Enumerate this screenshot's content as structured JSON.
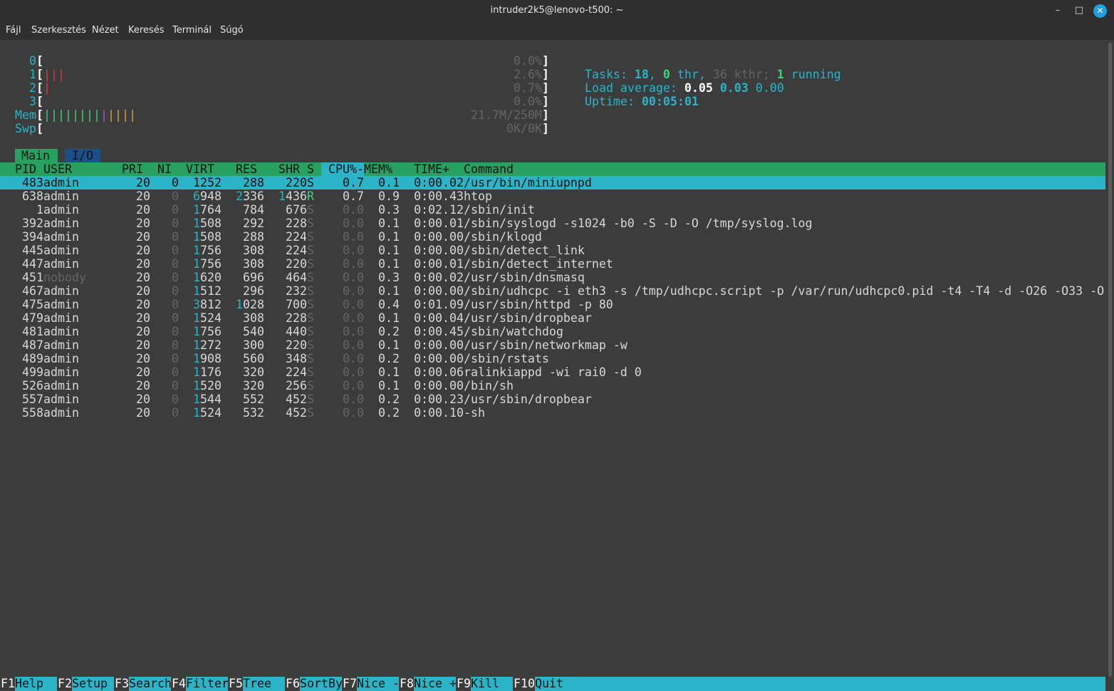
{
  "window": {
    "title": "intruder2k5@lenovo-t500: ~",
    "minimize_glyph": "–",
    "maximize_glyph": "□",
    "close_glyph": "✕"
  },
  "menu": [
    "Fájl",
    "Szerkesztés",
    "Nézet",
    "Keresés",
    "Terminál",
    "Súgó"
  ],
  "meters": {
    "cpus": [
      {
        "id": "0",
        "bars": "",
        "bar_colors": [],
        "pct": "0.0%"
      },
      {
        "id": "1",
        "bars": "|||",
        "bar_colors": [
          "red",
          "red",
          "red"
        ],
        "pct": "2.6%"
      },
      {
        "id": "2",
        "bars": "|",
        "bar_colors": [
          "red"
        ],
        "pct": "0.7%"
      },
      {
        "id": "3",
        "bars": "",
        "bar_colors": [],
        "pct": "0.0%"
      }
    ],
    "mem": {
      "label": "Mem",
      "bars": "|||||||||||||",
      "bar_colors": [
        "green",
        "green",
        "green",
        "green",
        "green",
        "green",
        "green",
        "green",
        "purple",
        "yellow",
        "yellow",
        "yellow",
        "yellow"
      ],
      "value": "21.7M/250M"
    },
    "swp": {
      "label": "Swp",
      "bars": "",
      "value": "0K/0K"
    },
    "tasks": {
      "label": "Tasks: ",
      "tasks": "18",
      "sep1": ", ",
      "thr": "0",
      "thr_label": " thr, ",
      "kthr": "36",
      "kthr_label": " kthr; ",
      "running": "1",
      "running_label": " running"
    },
    "load": {
      "label": "Load average: ",
      "l1": "0.05",
      "l5": "0.03",
      "l15": "0.00"
    },
    "uptime": {
      "label": "Uptime: ",
      "value": "00:05:01"
    }
  },
  "tabs": {
    "main": "Main",
    "io": "I/O"
  },
  "table": {
    "headers": {
      "pid": "PID",
      "user": "USER",
      "pri": "PRI",
      "ni": "NI",
      "virt": "VIRT",
      "res": "RES",
      "shr": "SHR",
      "s": "S",
      "cpu": "CPU%",
      "sort_marker": "-",
      "mem": "MEM%",
      "time": "TIME+",
      "command": "Command"
    },
    "rows": [
      {
        "pid": "483",
        "user": "admin",
        "pri": "20",
        "ni": "0",
        "virt": "1252",
        "res": "288",
        "shr": "220",
        "s": "S",
        "cpu": "0.7",
        "mem": "0.1",
        "time": "0:00.02",
        "command": "/usr/bin/miniupnpd"
      },
      {
        "pid": "638",
        "user": "admin",
        "pri": "20",
        "ni": "0",
        "virt": "6948",
        "res": "2336",
        "shr": "1436",
        "s": "R",
        "cpu": "0.7",
        "mem": "0.9",
        "time": "0:00.43",
        "command": "htop"
      },
      {
        "pid": "1",
        "user": "admin",
        "pri": "20",
        "ni": "0",
        "virt": "1764",
        "res": "784",
        "shr": "676",
        "s": "S",
        "cpu": "0.0",
        "mem": "0.3",
        "time": "0:02.12",
        "command": "/sbin/init"
      },
      {
        "pid": "392",
        "user": "admin",
        "pri": "20",
        "ni": "0",
        "virt": "1508",
        "res": "292",
        "shr": "228",
        "s": "S",
        "cpu": "0.0",
        "mem": "0.1",
        "time": "0:00.01",
        "command": "/sbin/syslogd -s1024 -b0 -S -D -O /tmp/syslog.log"
      },
      {
        "pid": "394",
        "user": "admin",
        "pri": "20",
        "ni": "0",
        "virt": "1508",
        "res": "288",
        "shr": "224",
        "s": "S",
        "cpu": "0.0",
        "mem": "0.1",
        "time": "0:00.00",
        "command": "/sbin/klogd"
      },
      {
        "pid": "445",
        "user": "admin",
        "pri": "20",
        "ni": "0",
        "virt": "1756",
        "res": "308",
        "shr": "224",
        "s": "S",
        "cpu": "0.0",
        "mem": "0.1",
        "time": "0:00.00",
        "command": "/sbin/detect_link"
      },
      {
        "pid": "447",
        "user": "admin",
        "pri": "20",
        "ni": "0",
        "virt": "1756",
        "res": "308",
        "shr": "220",
        "s": "S",
        "cpu": "0.0",
        "mem": "0.1",
        "time": "0:00.01",
        "command": "/sbin/detect_internet"
      },
      {
        "pid": "451",
        "user": "nobody",
        "pri": "20",
        "ni": "0",
        "virt": "1620",
        "res": "696",
        "shr": "464",
        "s": "S",
        "cpu": "0.0",
        "mem": "0.3",
        "time": "0:00.02",
        "command": "/usr/sbin/dnsmasq"
      },
      {
        "pid": "467",
        "user": "admin",
        "pri": "20",
        "ni": "0",
        "virt": "1512",
        "res": "296",
        "shr": "232",
        "s": "S",
        "cpu": "0.0",
        "mem": "0.1",
        "time": "0:00.00",
        "command": "/sbin/udhcpc -i eth3 -s /tmp/udhcpc.script -p /var/run/udhcpc0.pid -t4 -T4 -d -O26 -O33 -O"
      },
      {
        "pid": "475",
        "user": "admin",
        "pri": "20",
        "ni": "0",
        "virt": "3812",
        "res": "1028",
        "shr": "700",
        "s": "S",
        "cpu": "0.0",
        "mem": "0.4",
        "time": "0:01.09",
        "command": "/usr/sbin/httpd -p 80"
      },
      {
        "pid": "479",
        "user": "admin",
        "pri": "20",
        "ni": "0",
        "virt": "1524",
        "res": "308",
        "shr": "228",
        "s": "S",
        "cpu": "0.0",
        "mem": "0.1",
        "time": "0:00.04",
        "command": "/usr/sbin/dropbear"
      },
      {
        "pid": "481",
        "user": "admin",
        "pri": "20",
        "ni": "0",
        "virt": "1756",
        "res": "540",
        "shr": "440",
        "s": "S",
        "cpu": "0.0",
        "mem": "0.2",
        "time": "0:00.45",
        "command": "/sbin/watchdog"
      },
      {
        "pid": "487",
        "user": "admin",
        "pri": "20",
        "ni": "0",
        "virt": "1272",
        "res": "300",
        "shr": "220",
        "s": "S",
        "cpu": "0.0",
        "mem": "0.1",
        "time": "0:00.00",
        "command": "/usr/sbin/networkmap -w"
      },
      {
        "pid": "489",
        "user": "admin",
        "pri": "20",
        "ni": "0",
        "virt": "1908",
        "res": "560",
        "shr": "348",
        "s": "S",
        "cpu": "0.0",
        "mem": "0.2",
        "time": "0:00.00",
        "command": "/sbin/rstats"
      },
      {
        "pid": "499",
        "user": "admin",
        "pri": "20",
        "ni": "0",
        "virt": "1176",
        "res": "320",
        "shr": "224",
        "s": "S",
        "cpu": "0.0",
        "mem": "0.1",
        "time": "0:00.06",
        "command": "ralinkiappd -wi rai0 -d 0"
      },
      {
        "pid": "526",
        "user": "admin",
        "pri": "20",
        "ni": "0",
        "virt": "1520",
        "res": "320",
        "shr": "256",
        "s": "S",
        "cpu": "0.0",
        "mem": "0.1",
        "time": "0:00.00",
        "command": "/bin/sh"
      },
      {
        "pid": "557",
        "user": "admin",
        "pri": "20",
        "ni": "0",
        "virt": "1544",
        "res": "552",
        "shr": "452",
        "s": "S",
        "cpu": "0.0",
        "mem": "0.2",
        "time": "0:00.23",
        "command": "/usr/sbin/dropbear"
      },
      {
        "pid": "558",
        "user": "admin",
        "pri": "20",
        "ni": "0",
        "virt": "1524",
        "res": "532",
        "shr": "452",
        "s": "S",
        "cpu": "0.0",
        "mem": "0.2",
        "time": "0:00.10",
        "command": "-sh"
      }
    ]
  },
  "footer": [
    {
      "key": "F1",
      "label": "Help"
    },
    {
      "key": "F2",
      "label": "Setup"
    },
    {
      "key": "F3",
      "label": "Search"
    },
    {
      "key": "F4",
      "label": "Filter"
    },
    {
      "key": "F5",
      "label": "Tree"
    },
    {
      "key": "F6",
      "label": "SortBy"
    },
    {
      "key": "F7",
      "label": "Nice -"
    },
    {
      "key": "F8",
      "label": "Nice +"
    },
    {
      "key": "F9",
      "label": "Kill"
    },
    {
      "key": "F10",
      "label": "Quit"
    }
  ],
  "colors": {
    "accent_cyan": "#2bb3c8",
    "accent_green": "#28a060",
    "io_tab_blue": "#1a4f8a",
    "background": "#3c3c3c"
  }
}
